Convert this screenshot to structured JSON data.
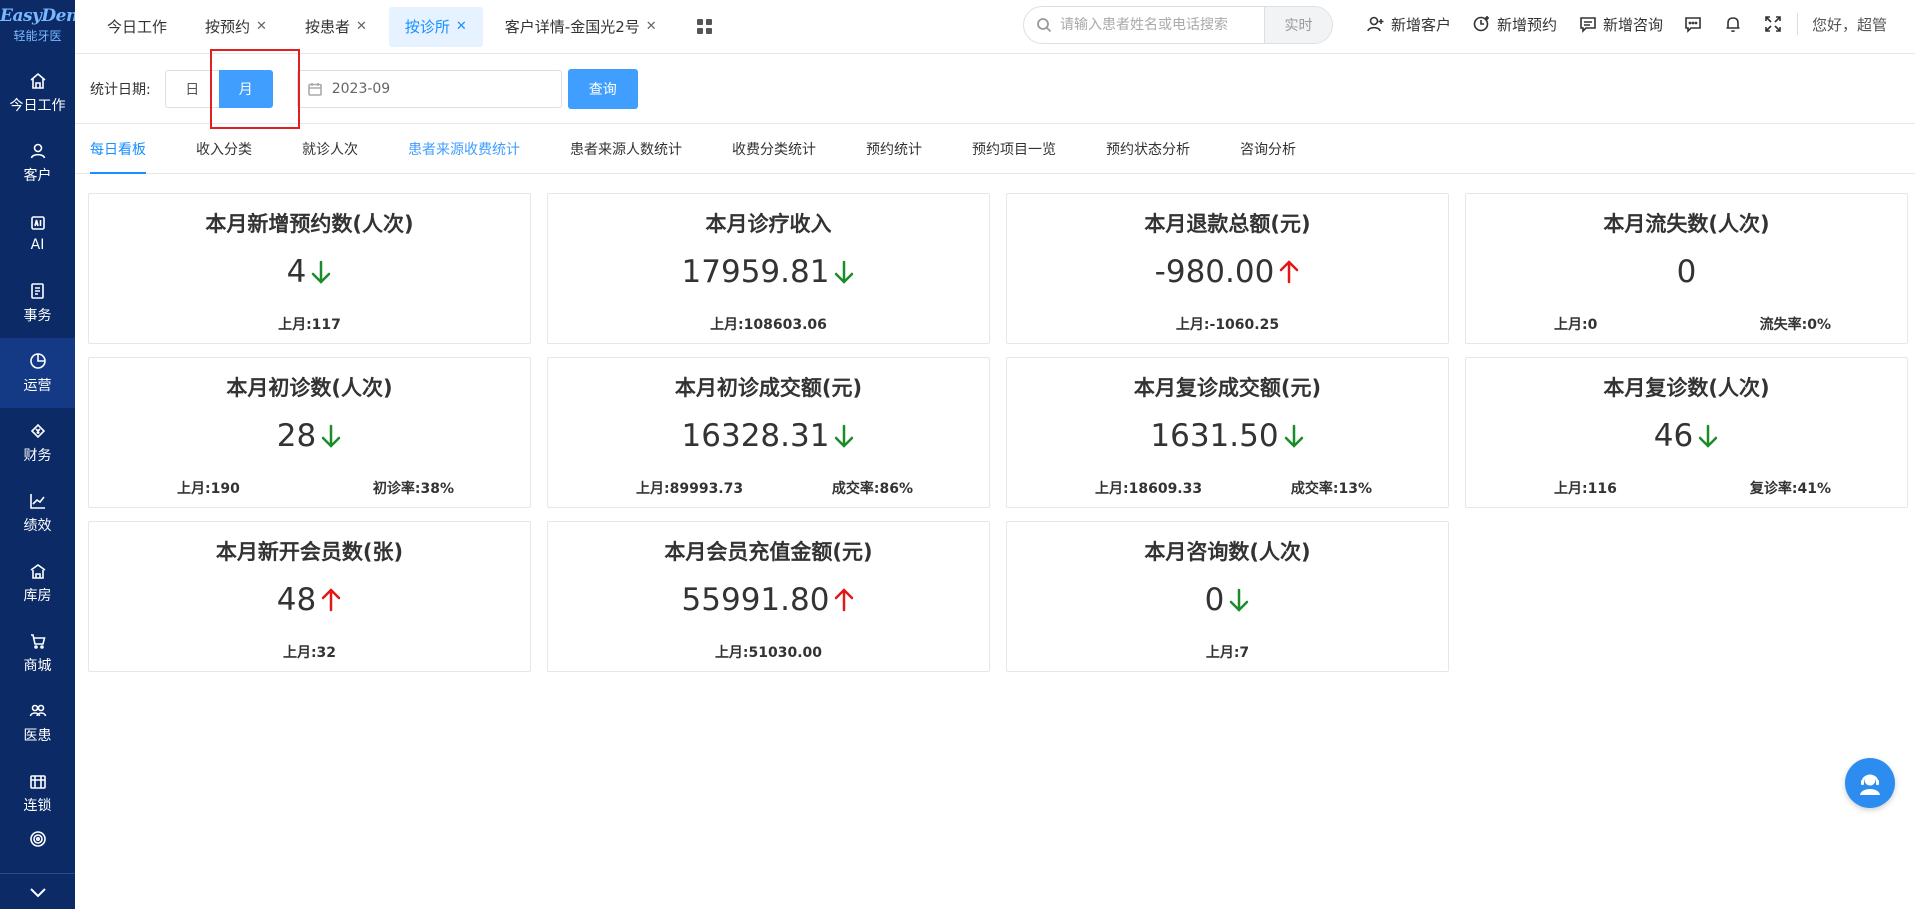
{
  "app": {
    "logo_main": "EasyDent",
    "logo_sub": "轻能牙医"
  },
  "sidebar": {
    "items": [
      {
        "label": "今日工作",
        "icon": "home-icon"
      },
      {
        "label": "客户",
        "icon": "user-icon"
      },
      {
        "label": "AI",
        "icon": "ai-chip-icon"
      },
      {
        "label": "事务",
        "icon": "task-icon"
      },
      {
        "label": "运营",
        "icon": "pie-chart-icon"
      },
      {
        "label": "财务",
        "icon": "money-icon"
      },
      {
        "label": "绩效",
        "icon": "trend-icon"
      },
      {
        "label": "库房",
        "icon": "warehouse-icon"
      },
      {
        "label": "商城",
        "icon": "cart-icon"
      },
      {
        "label": "医患",
        "icon": "doctor-patient-icon"
      },
      {
        "label": "连锁",
        "icon": "chain-store-icon"
      }
    ]
  },
  "tabs": [
    {
      "label": "今日工作"
    },
    {
      "label": "按预约"
    },
    {
      "label": "按患者"
    },
    {
      "label": "按诊所"
    },
    {
      "label": "客户详情-金国光2号"
    }
  ],
  "search": {
    "placeholder": "请输入患者姓名或电话搜索",
    "mode": "实时"
  },
  "actions": {
    "new_customer": "新增客户",
    "new_appointment": "新增预约",
    "new_consult": "新增咨询",
    "greeting": "您好，超管"
  },
  "filter": {
    "label": "统计日期:",
    "day": "日",
    "month": "月",
    "date_value": "2023-09",
    "query": "查询"
  },
  "subtabs": [
    "每日看板",
    "收入分类",
    "就诊人次",
    "患者来源收费统计",
    "患者来源人数统计",
    "收费分类统计",
    "预约统计",
    "预约项目一览",
    "预约状态分析",
    "咨询分析"
  ],
  "cards": [
    {
      "title": "本月新增预约数(人次)",
      "value": "4",
      "trend": "down",
      "left": "上月:117",
      "right": ""
    },
    {
      "title": "本月诊疗收入",
      "value": "17959.81",
      "trend": "down",
      "left": "上月:108603.06",
      "right": ""
    },
    {
      "title": "本月退款总额(元)",
      "value": "-980.00",
      "trend": "up",
      "left": "上月:-1060.25",
      "right": ""
    },
    {
      "title": "本月流失数(人次)",
      "value": "0",
      "trend": "",
      "left": "上月:0",
      "right": "流失率:0%"
    },
    {
      "title": "本月初诊数(人次)",
      "value": "28",
      "trend": "down",
      "left": "上月:190",
      "right": "初诊率:38%"
    },
    {
      "title": "本月初诊成交额(元)",
      "value": "16328.31",
      "trend": "down",
      "left": "上月:89993.73",
      "right": "成交率:86%"
    },
    {
      "title": "本月复诊成交额(元)",
      "value": "1631.50",
      "trend": "down",
      "left": "上月:18609.33",
      "right": "成交率:13%"
    },
    {
      "title": "本月复诊数(人次)",
      "value": "46",
      "trend": "down",
      "left": "上月:116",
      "right": "复诊率:41%"
    },
    {
      "title": "本月新开会员数(张)",
      "value": "48",
      "trend": "up",
      "left": "上月:32",
      "right": ""
    },
    {
      "title": "本月会员充值金额(元)",
      "value": "55991.80",
      "trend": "up",
      "left": "上月:51030.00",
      "right": ""
    },
    {
      "title": "本月咨询数(人次)",
      "value": "0",
      "trend": "down",
      "left": "上月:7",
      "right": ""
    }
  ],
  "colors": {
    "sidebar_bg": "#0b2a66",
    "primary": "#409eff",
    "trend_down": "#1a8c2a",
    "trend_up": "#e01818",
    "highlight": "#e02020"
  }
}
